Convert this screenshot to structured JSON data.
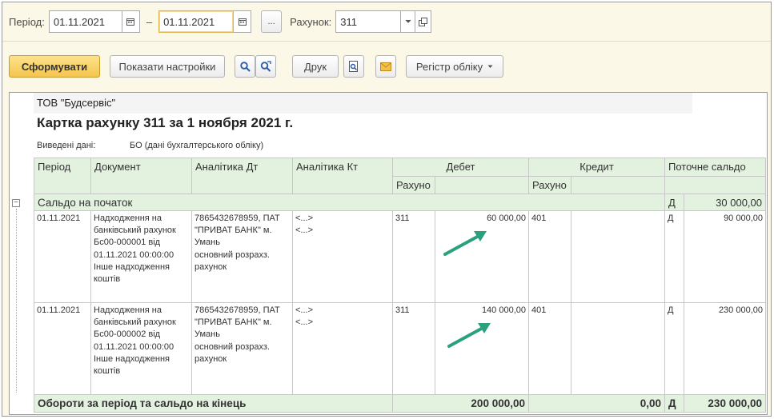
{
  "toolbar": {
    "period_label": "Період:",
    "date_from": "01.11.2021",
    "dash": "–",
    "date_to": "01.11.2021",
    "more_label": "...",
    "account_label": "Рахунок:",
    "account_value": "311",
    "generate_label": "Сформувати",
    "show_settings_label": "Показати настройки",
    "print_label": "Друк",
    "register_label": "Регістр обліку"
  },
  "report": {
    "org": "ТОВ \"Будсервіс\"",
    "title": "Картка рахунку 311 за 1 ноября 2021 г.",
    "meta_label": "Виведені дані:",
    "meta_value": "БО (дані бухгалтерського обліку)",
    "headers": {
      "period": "Період",
      "document": "Документ",
      "analytics_dt": "Аналітика Дт",
      "analytics_kt": "Аналітика Кт",
      "debit": "Дебет",
      "credit": "Кредит",
      "balance": "Поточне сальдо",
      "debit_account": "Рахуно",
      "credit_account": "Рахуно"
    },
    "opening": {
      "label": "Сальдо на початок",
      "side": "Д",
      "amount": "30 000,00"
    },
    "rows": [
      {
        "period": "01.11.2021",
        "document": [
          "Надходження на",
          "банківський рахунок",
          "Бс00-000001 від",
          "01.11.2021 00:00:00",
          "Інше надходження",
          "коштів"
        ],
        "analytics_dt": [
          "7865432678959, ПАТ",
          "\"ПРИВАТ БАНК\" м.",
          "Умань",
          "основний розрахз.",
          "рахунок"
        ],
        "analytics_kt": [
          "<...>",
          "<...>"
        ],
        "debit_account": "311",
        "debit_amount": "60 000,00",
        "credit_account": "401",
        "credit_amount": "",
        "balance_side": "Д",
        "balance_amount": "90 000,00"
      },
      {
        "period": "01.11.2021",
        "document": [
          "Надходження на",
          "банківський рахунок",
          "Бс00-000002 від",
          "01.11.2021 00:00:00",
          "Інше надходження",
          "коштів"
        ],
        "analytics_dt": [
          "7865432678959, ПАТ",
          "\"ПРИВАТ БАНК\" м.",
          "Умань",
          "основний розрахз.",
          "рахунок"
        ],
        "analytics_kt": [
          "<...>",
          "<...>"
        ],
        "debit_account": "311",
        "debit_amount": "140 000,00",
        "credit_account": "401",
        "credit_amount": "",
        "balance_side": "Д",
        "balance_amount": "230 000,00"
      }
    ],
    "totals": {
      "label": "Обороти за період та сальдо на кінець",
      "debit": "200 000,00",
      "credit": "0,00",
      "side": "Д",
      "balance": "230 000,00"
    }
  },
  "colors": {
    "header_green": "#e3f1df",
    "toolbar_bg": "#fbf8e7",
    "primary_button": "#f5c44e",
    "annotation_arrow": "#2aa07f"
  }
}
